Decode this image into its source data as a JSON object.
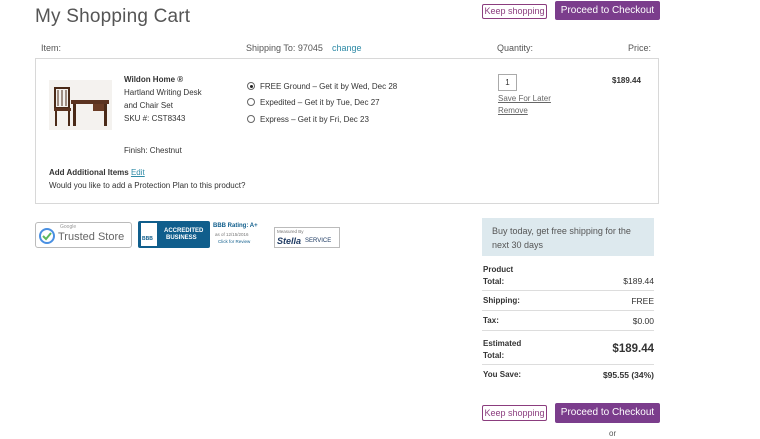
{
  "page": {
    "title": "My Shopping Cart"
  },
  "top_actions": {
    "keep_shopping": "Keep shopping",
    "checkout": "Proceed to Checkout"
  },
  "headers": {
    "item": "Item:",
    "shipping_to": "Shipping To: 97045",
    "change": "change",
    "quantity": "Quantity:",
    "price": "Price:"
  },
  "item": {
    "brand": "Wildon Home ®",
    "name_line1": "Hartland Writing Desk",
    "name_line2": "and Chair Set",
    "sku": "SKU #: CST8343",
    "finish": "Finish: Chestnut",
    "quantity": "1",
    "save_for_later": "Save For Later",
    "remove": "Remove",
    "price": "$189.44",
    "add_items_label": "Add Additional Items",
    "edit": "Edit",
    "protection_question": "Would you like to add a Protection Plan to this product?"
  },
  "shipping_options": [
    {
      "label": "FREE Ground – Get it by Wed, Dec 28",
      "selected": true
    },
    {
      "label": "Expedited – Get it by Tue, Dec 27",
      "selected": false
    },
    {
      "label": "Express – Get it by Fri, Dec 23",
      "selected": false
    }
  ],
  "badges": {
    "google_small": "Google",
    "google_main": "Trusted Store",
    "bbb_line1": "ACCREDITED",
    "bbb_line2": "BUSINESS",
    "bbb_logo": "BBB",
    "bbb_rating": "BBB Rating: A+",
    "bbb_date": "as of 12/15/2016",
    "bbb_review": "Click for Review",
    "stella_small": "Measured By",
    "stella_main": "Stella",
    "stella_service": "SERVICE"
  },
  "promo": {
    "text": "Buy today, get free shipping for the next 30 days"
  },
  "summary": {
    "product_total_label_1": "Product",
    "product_total_label_2": "Total:",
    "product_total": "$189.44",
    "shipping_label": "Shipping:",
    "shipping": "FREE",
    "tax_label": "Tax:",
    "tax": "$0.00",
    "estimated_label_1": "Estimated",
    "estimated_label_2": "Total:",
    "estimated_total": "$189.44",
    "you_save_label": "You Save:",
    "you_save": "$95.55 (34%)"
  },
  "bottom_actions": {
    "keep_shopping": "Keep shopping",
    "checkout": "Proceed to Checkout",
    "or": "or"
  },
  "colors": {
    "accent": "#7b3d8c",
    "link": "#2e8aa6",
    "promo_bg": "#dde9ee"
  }
}
